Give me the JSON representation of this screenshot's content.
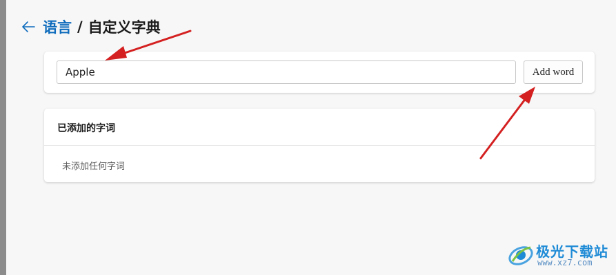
{
  "header": {
    "back_icon": "arrow-left-icon",
    "parent_label": "语言",
    "separator": "/",
    "title": "自定义字典"
  },
  "input_card": {
    "word_value": "Apple",
    "add_button_label": "Add word"
  },
  "list_card": {
    "heading": "已添加的字词",
    "empty_message": "未添加任何字词"
  },
  "watermark": {
    "name": "极光下载站",
    "url": "www.xz7.com"
  },
  "colors": {
    "link": "#0f6cbd",
    "annotation_arrow": "#d42020",
    "background": "#f7f7f7"
  }
}
